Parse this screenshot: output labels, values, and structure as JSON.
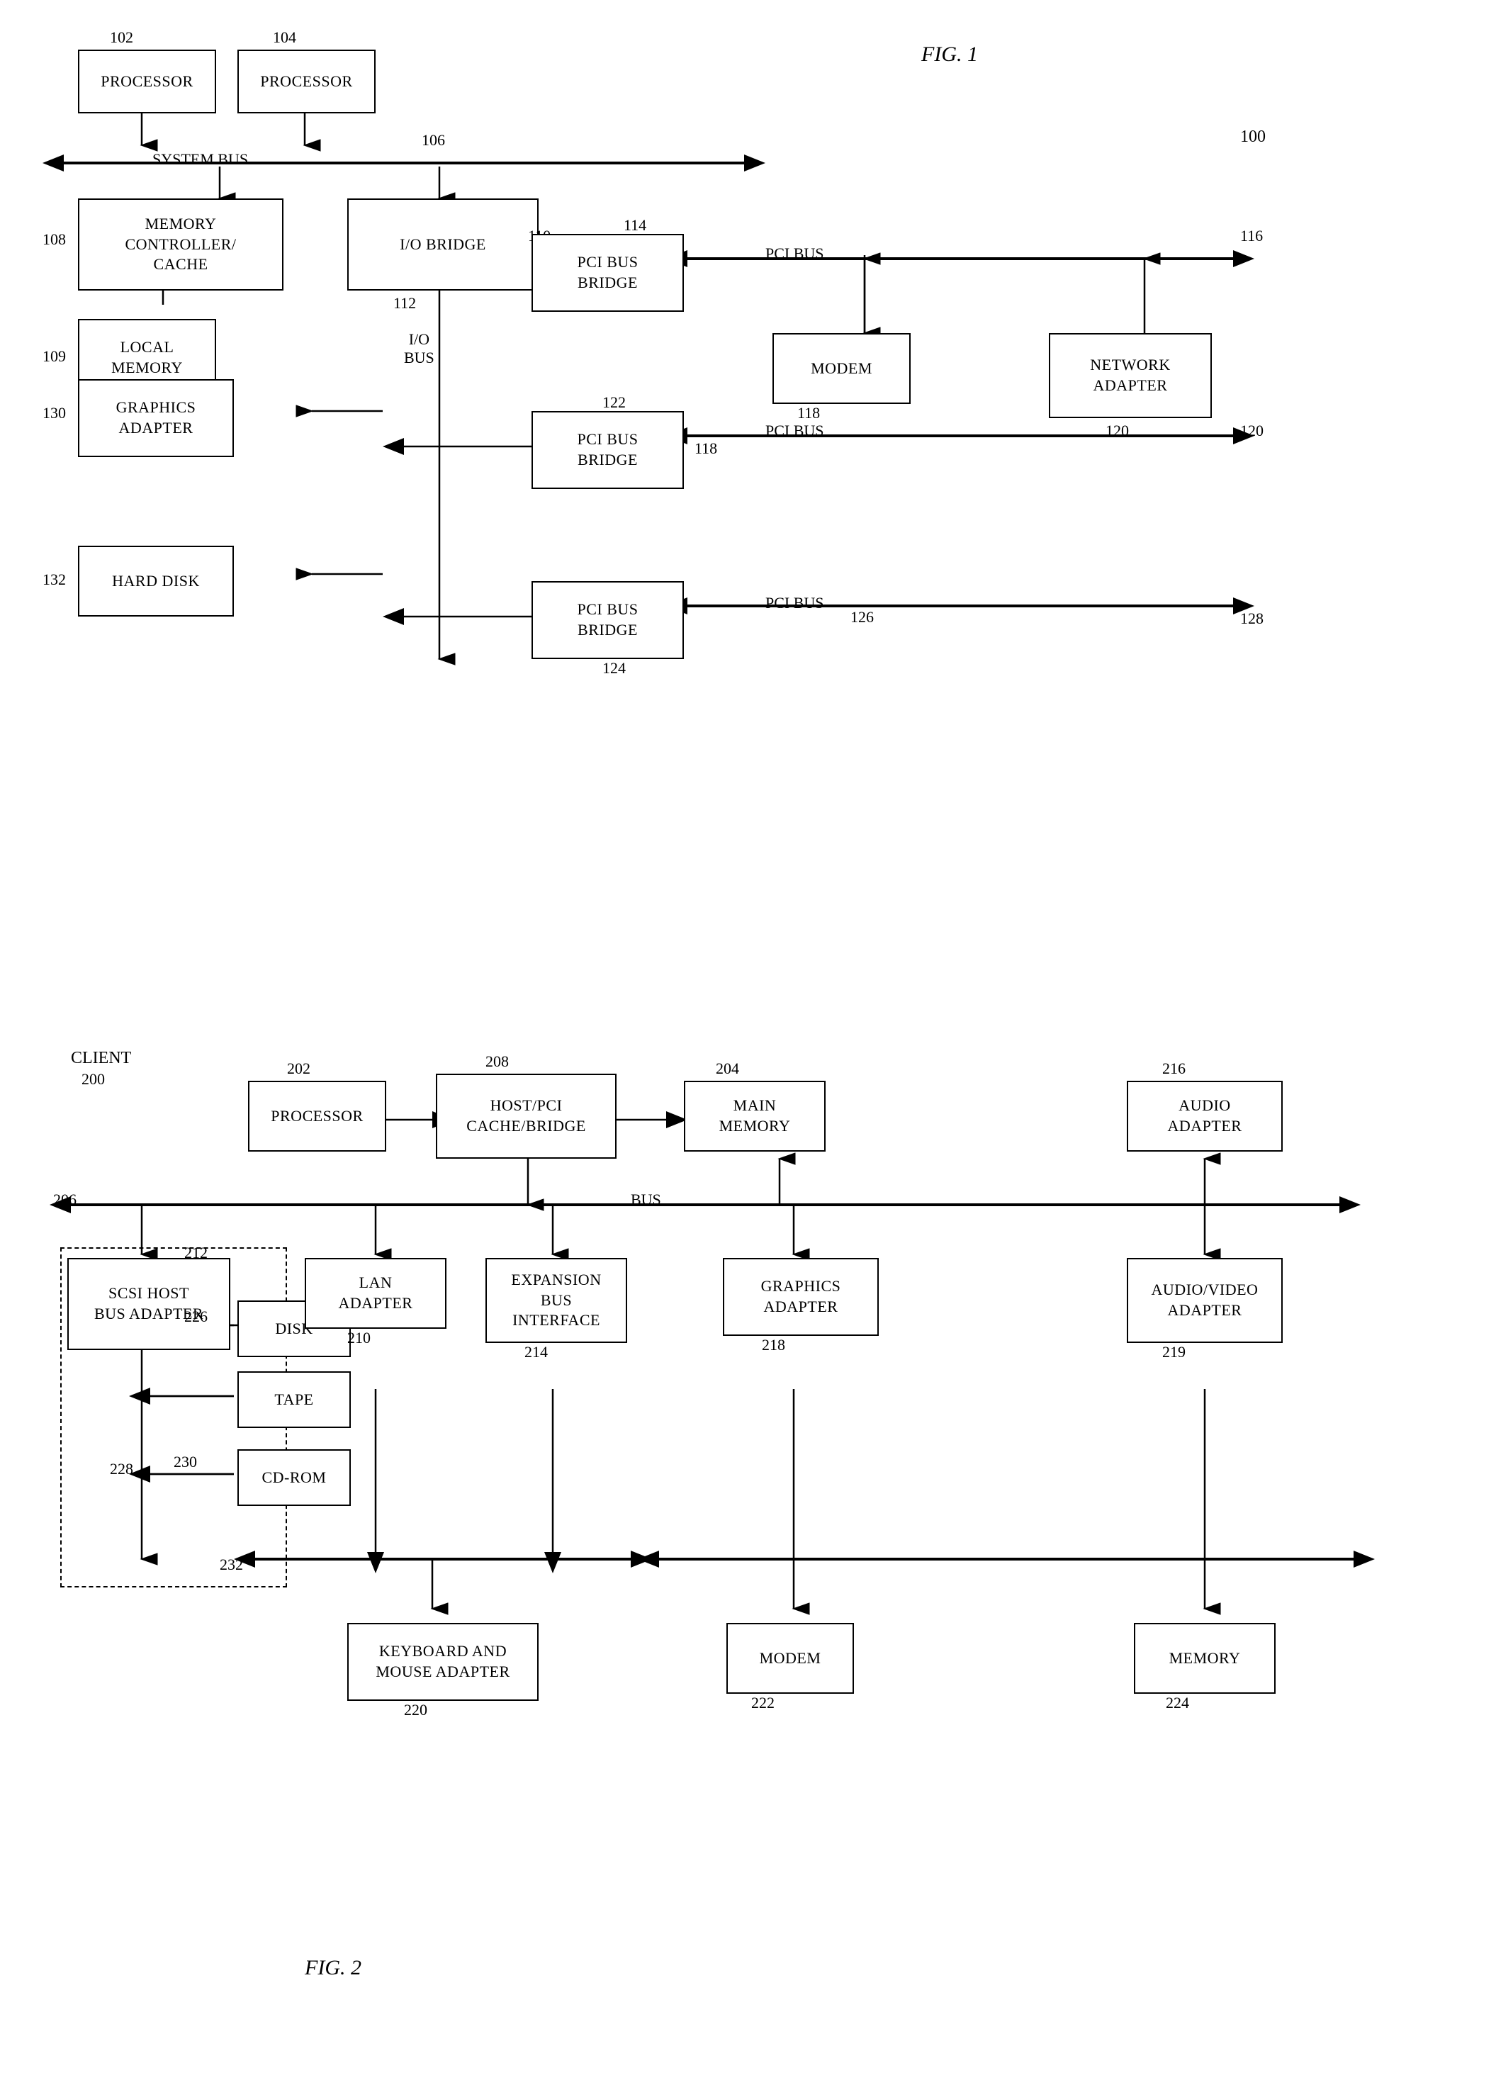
{
  "fig1": {
    "title": "FIG. 1",
    "ref_100": "100",
    "ref_102": "102",
    "ref_104": "104",
    "ref_106": "106",
    "ref_108": "108",
    "ref_109": "109",
    "ref_110": "110",
    "ref_112": "112",
    "ref_114": "114",
    "ref_116": "116",
    "ref_118": "118",
    "ref_120": "120",
    "ref_122": "122",
    "ref_124": "124",
    "ref_126": "126",
    "ref_128": "128",
    "ref_130": "130",
    "ref_132": "132",
    "processor1": "PROCESSOR",
    "processor2": "PROCESSOR",
    "system_bus": "SYSTEM BUS",
    "memory_controller": "MEMORY\nCONTROLLER/\nCACHE",
    "io_bridge": "I/O BRIDGE",
    "local_memory": "LOCAL\nMEMORY",
    "pci_bus_bridge1": "PCI BUS\nBRIDGE",
    "pci_bus1": "PCI BUS",
    "modem": "MODEM",
    "network_adapter": "NETWORK\nADAPTER",
    "io_bus": "I/O\nBUS",
    "pci_bus_bridge2": "PCI BUS\nBRIDGE",
    "pci_bus2": "PCI BUS",
    "pci_bus_bridge3": "PCI BUS\nBRIDGE",
    "pci_bus3": "PCI BUS",
    "graphics_adapter": "GRAPHICS\nADAPTER",
    "hard_disk": "HARD DISK"
  },
  "fig2": {
    "title": "FIG. 2",
    "ref_200": "200",
    "ref_202": "202",
    "ref_204": "204",
    "ref_206": "206",
    "ref_208": "208",
    "ref_210": "210",
    "ref_212": "212",
    "ref_214": "214",
    "ref_216": "216",
    "ref_218": "218",
    "ref_219": "219",
    "ref_220": "220",
    "ref_222": "222",
    "ref_224": "224",
    "ref_226": "226",
    "ref_228": "228",
    "ref_230": "230",
    "ref_232": "232",
    "client": "CLIENT",
    "processor": "PROCESSOR",
    "host_pci": "HOST/PCI\nCACHE/BRIDGE",
    "main_memory": "MAIN\nMEMORY",
    "audio_adapter": "AUDIO\nADAPTER",
    "bus": "BUS",
    "scsi_host": "SCSI HOST\nBUS ADAPTER",
    "disk": "DISK",
    "tape": "TAPE",
    "cd_rom": "CD-ROM",
    "lan_adapter": "LAN\nADAPTER",
    "expansion_bus": "EXPANSION\nBUS\nINTERFACE",
    "graphics_adapter": "GRAPHICS\nADAPTER",
    "audio_video": "AUDIO/VIDEO\nADAPTER",
    "keyboard_mouse": "KEYBOARD AND\nMOUSE ADAPTER",
    "modem": "MODEM",
    "memory": "MEMORY"
  }
}
